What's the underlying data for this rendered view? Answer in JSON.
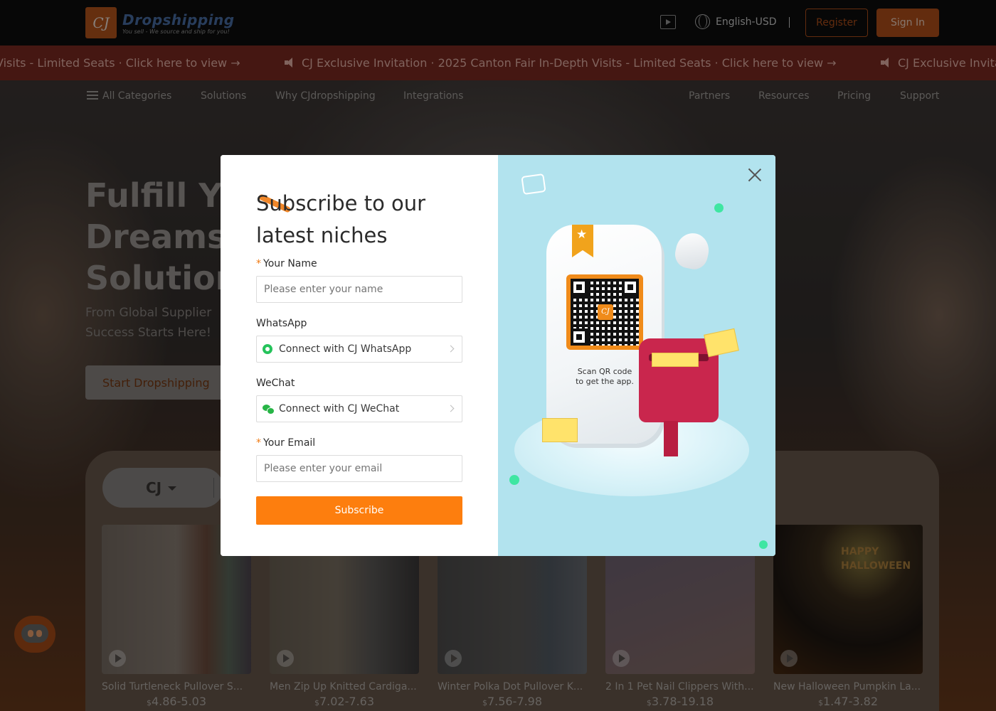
{
  "header": {
    "logo_mark": "CJ",
    "logo_name": "Dropshipping",
    "logo_tagline": "You sell - We source and ship for you!",
    "language": "English-USD",
    "register_label": "Register",
    "signin_label": "Sign In"
  },
  "ribbon": {
    "items": [
      "Visits - Limited Seats · Click here to view →",
      "CJ Exclusive Invitation · 2025 Canton Fair In-Depth Visits - Limited Seats · Click here to view →",
      "CJ Exclusive Invitation"
    ]
  },
  "nav": {
    "all_categories": "All Categories",
    "items": [
      "Solutions",
      "Why CJdropshipping",
      "Integrations",
      "Partners",
      "Resources",
      "Pricing",
      "Support"
    ]
  },
  "hero": {
    "title_lines": [
      "Fulfill Yo",
      "Dreams",
      "Solution"
    ],
    "subtitle_lines": [
      "From Global Supplier",
      "Success Starts Here!"
    ],
    "cta_label": "Start Dropshipping"
  },
  "selector": {
    "label": "CJ"
  },
  "products": [
    {
      "name": "Solid Turtleneck Pullover S...",
      "currency": "$",
      "price": "4.86-5.03"
    },
    {
      "name": "Men Zip Up Knitted Cardiga...",
      "currency": "$",
      "price": "7.02-7.63"
    },
    {
      "name": "Winter Polka Dot Pullover K...",
      "currency": "$",
      "price": "7.56-7.98"
    },
    {
      "name": "2 In 1 Pet Nail Clippers With...",
      "currency": "$",
      "price": "3.78-19.18"
    },
    {
      "name": "New Halloween Pumpkin La...",
      "currency": "$",
      "price": "1.47-3.82"
    }
  ],
  "modal": {
    "title": "Subscribe to our latest niches",
    "name_label": "Your Name",
    "name_placeholder": "Please enter your name",
    "whatsapp_label": "WhatsApp",
    "whatsapp_connect": "Connect with CJ WhatsApp",
    "wechat_label": "WeChat",
    "wechat_connect": "Connect with CJ WeChat",
    "email_label": "Your Email",
    "email_placeholder": "Please enter your email",
    "required_mark": "*",
    "subscribe_label": "Subscribe",
    "qr_caption_1": "Scan QR code",
    "qr_caption_2": "to get the app.",
    "qr_logo": "CJ",
    "halloween_text_1": "HAPPY",
    "halloween_text_2": "HALLOWEEN"
  },
  "colors": {
    "brand_orange": "#fd7e0e",
    "ribbon_red": "#7e2a22",
    "modal_illustration_bg": "#b2e3ee",
    "register_border": "#b5501a"
  }
}
